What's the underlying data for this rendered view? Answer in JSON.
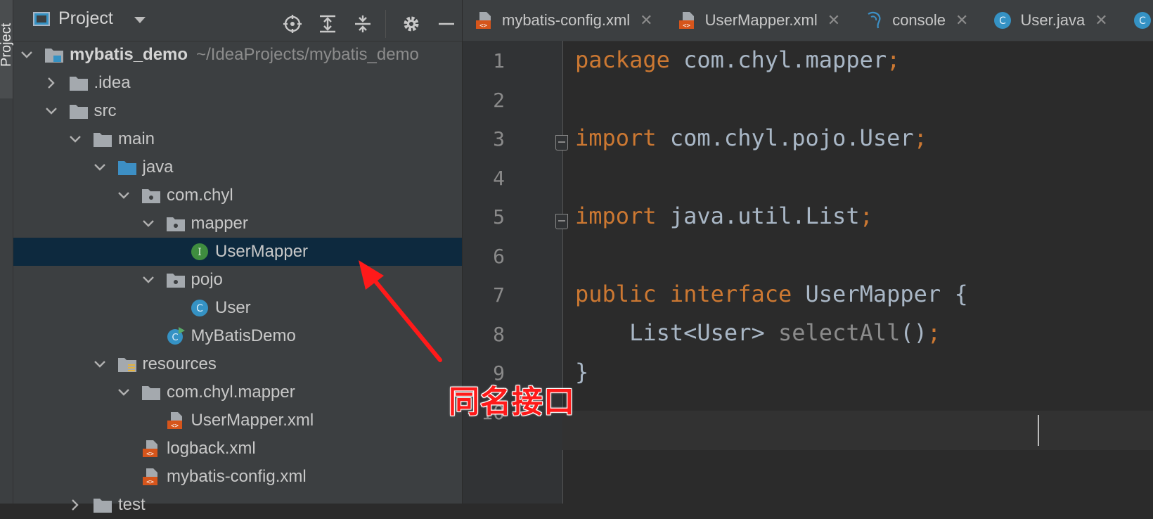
{
  "tool_window": {
    "vertical_label": "Project"
  },
  "project_panel": {
    "title": "Project",
    "tree": [
      {
        "label": "mybatis_demo",
        "extra": "~/IdeaProjects/mybatis_demo",
        "icon": "module-folder-icon",
        "depth": 0,
        "expanded": true
      },
      {
        "label": ".idea",
        "icon": "folder-icon",
        "depth": 1,
        "expanded": false
      },
      {
        "label": "src",
        "icon": "folder-icon",
        "depth": 1,
        "expanded": true
      },
      {
        "label": "main",
        "icon": "folder-icon",
        "depth": 2,
        "expanded": true
      },
      {
        "label": "java",
        "icon": "source-folder-icon",
        "depth": 3,
        "expanded": true
      },
      {
        "label": "com.chyl",
        "icon": "package-icon",
        "depth": 4,
        "expanded": true
      },
      {
        "label": "mapper",
        "icon": "package-icon",
        "depth": 5,
        "expanded": true
      },
      {
        "label": "UserMapper",
        "icon": "interface-icon",
        "depth": 6,
        "selected": true
      },
      {
        "label": "pojo",
        "icon": "package-icon",
        "depth": 5,
        "expanded": true
      },
      {
        "label": "User",
        "icon": "class-icon",
        "depth": 6
      },
      {
        "label": "MyBatisDemo",
        "icon": "runnable-class-icon",
        "depth": 5
      },
      {
        "label": "resources",
        "icon": "resources-folder-icon",
        "depth": 3,
        "expanded": true
      },
      {
        "label": "com.chyl.mapper",
        "icon": "folder-icon",
        "depth": 4,
        "expanded": true
      },
      {
        "label": "UserMapper.xml",
        "icon": "xml-file-icon",
        "depth": 5
      },
      {
        "label": "logback.xml",
        "icon": "xml-file-icon",
        "depth": 4
      },
      {
        "label": "mybatis-config.xml",
        "icon": "xml-file-icon",
        "depth": 4
      },
      {
        "label": "test",
        "icon": "folder-icon",
        "depth": 2,
        "expanded": false
      }
    ]
  },
  "editor": {
    "tabs": [
      {
        "label": "mybatis-config.xml",
        "icon": "xml-file-icon"
      },
      {
        "label": "UserMapper.xml",
        "icon": "xml-file-icon"
      },
      {
        "label": "console",
        "icon": "database-console-icon"
      },
      {
        "label": "User.java",
        "icon": "class-icon"
      }
    ],
    "line_numbers": [
      "1",
      "2",
      "3",
      "4",
      "5",
      "6",
      "7",
      "8",
      "9",
      "10"
    ],
    "code": {
      "l1_kw": "package",
      "l1_rest": " com.chyl.mapper",
      "l1_semi": ";",
      "l3_kw": "import",
      "l3_rest": " com.chyl.pojo.User",
      "l3_semi": ";",
      "l5_kw": "import",
      "l5_rest": " java.util.List",
      "l5_semi": ";",
      "l7_kw1": "public",
      "l7_kw2": " interface",
      "l7_rest": " UserMapper {",
      "l8_type": "    List<User> ",
      "l8_method": "selectAll",
      "l8_paren": "()",
      "l8_semi": ";",
      "l9": "}"
    }
  },
  "annotation": {
    "label": "同名接口",
    "color": "#ff1a1a"
  },
  "colors": {
    "keyword": "#cc7832",
    "selection": "#0d293e",
    "panel": "#3c3f41",
    "editor_bg": "#2b2b2b"
  }
}
